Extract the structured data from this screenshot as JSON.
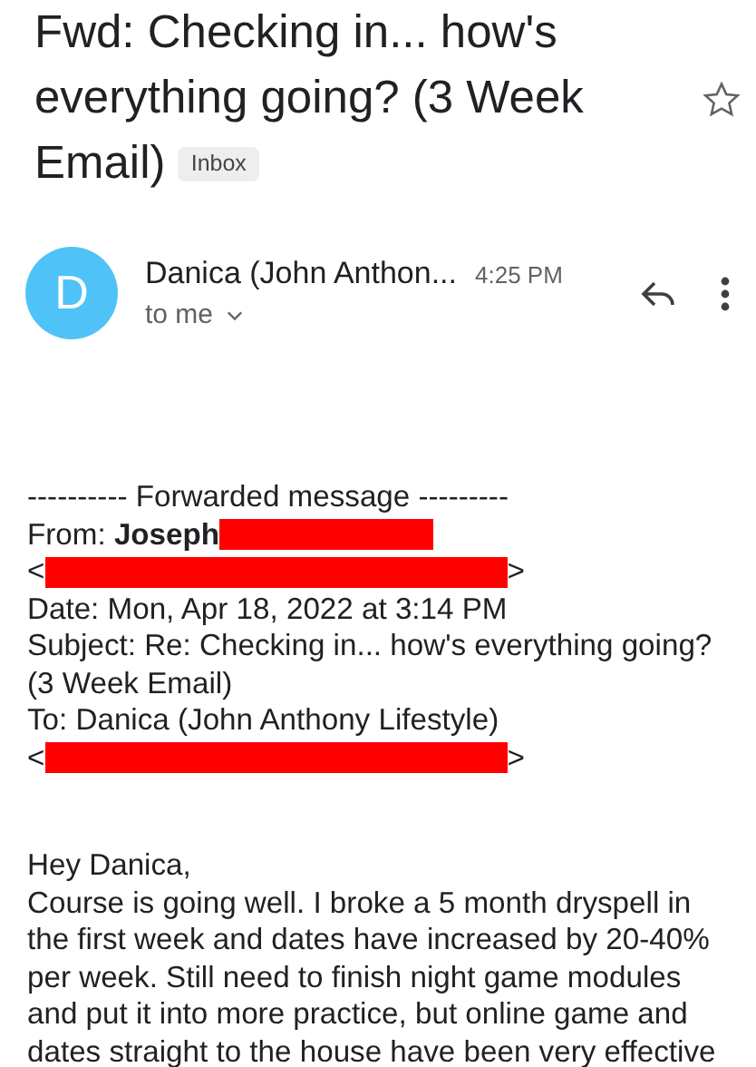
{
  "subject": "Fwd: Checking in... how's everything going? (3 Week Email)",
  "label": "Inbox",
  "starred": false,
  "sender": {
    "initial": "D",
    "name": "Danica (John Anthon...",
    "time": "4:25 PM",
    "recipient": "to me"
  },
  "forwarded": {
    "divider": "---------- Forwarded message ---------",
    "lines": [
      {
        "before": "From: **Joseph**",
        "kind": "redacted_name"
      },
      {
        "before": "<",
        "after": ">",
        "kind": "redacted_address"
      },
      {
        "before": "Date: Mon, Apr 18, 2022 at 3:14 PM",
        "kind": "plain"
      },
      {
        "before": "Subject: Re: Checking in... how's everything going? (3 Week Email)",
        "kind": "plain"
      },
      {
        "before": "To: Danica (John Anthony Lifestyle)",
        "kind": "plain"
      },
      {
        "before": "<",
        "after": ">",
        "kind": "redacted_address"
      }
    ]
  },
  "body": {
    "greeting": "Hey Danica,",
    "paragraph": "Course is going well. I broke a 5 month dryspell in the first week and dates have increased by 20-40% per week. Still need to finish night game modules and put it into more practice, but online game and dates straight to the house have been very effective"
  }
}
